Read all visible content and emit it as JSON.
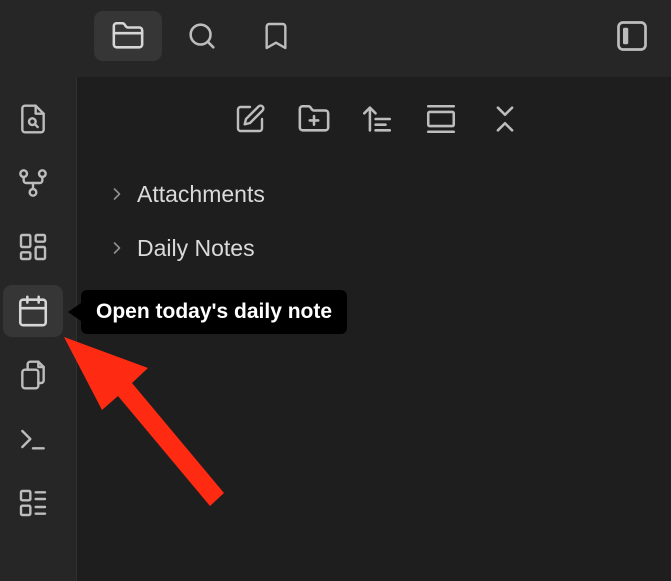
{
  "top_tabs": [
    {
      "icon": "folder-icon",
      "active": true
    },
    {
      "icon": "search-icon",
      "active": false
    },
    {
      "icon": "bookmark-icon",
      "active": false
    }
  ],
  "sidebar_toggle_icon": "sidebar-toggle-icon",
  "ribbon": [
    {
      "icon": "quick-switcher-icon"
    },
    {
      "icon": "graph-view-icon"
    },
    {
      "icon": "canvas-icon"
    },
    {
      "icon": "calendar-icon",
      "active": true
    },
    {
      "icon": "templates-icon"
    },
    {
      "icon": "command-palette-icon"
    },
    {
      "icon": "bases-icon"
    }
  ],
  "nav_buttons": [
    {
      "icon": "new-note-icon"
    },
    {
      "icon": "new-folder-icon"
    },
    {
      "icon": "sort-icon"
    },
    {
      "icon": "auto-reveal-icon"
    },
    {
      "icon": "collapse-all-icon"
    }
  ],
  "file_tree": [
    {
      "label": "Attachments"
    },
    {
      "label": "Daily Notes"
    }
  ],
  "tooltip": {
    "text": "Open today's daily note"
  },
  "colors": {
    "background": "#1e1e1e",
    "panel": "#262626",
    "active": "#363636",
    "icon": "#bdbdbd",
    "text": "#dadada",
    "tooltip_bg": "#000000",
    "arrow": "#ff2a12"
  }
}
